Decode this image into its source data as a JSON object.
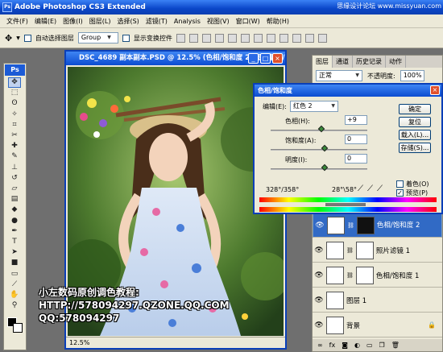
{
  "app": {
    "title": "Adobe Photoshop CS3 Extended",
    "logo": "Ps",
    "watermark": "思缘设计论坛 www.missyuan.com"
  },
  "menubar": [
    "文件(F)",
    "编辑(E)",
    "图像(I)",
    "图层(L)",
    "选择(S)",
    "滤镜(T)",
    "Analysis",
    "视图(V)",
    "窗口(W)",
    "帮助(H)"
  ],
  "options": {
    "auto_select_label": "自动选择图层",
    "auto_select_value": "Group",
    "show_transform_label": "显示变换控件"
  },
  "toolbox": {
    "logo": "Ps",
    "tools": [
      "move-icon",
      "marquee-icon",
      "lasso-icon",
      "magic-wand-icon",
      "crop-icon",
      "slice-icon",
      "healing-icon",
      "brush-icon",
      "stamp-icon",
      "history-brush-icon",
      "eraser-icon",
      "gradient-icon",
      "blur-icon",
      "dodge-icon",
      "pen-icon",
      "type-icon",
      "path-select-icon",
      "shape-icon",
      "notes-icon",
      "eyedropper-icon",
      "hand-icon",
      "zoom-icon"
    ]
  },
  "document": {
    "title": "DSC_4689 副本副本.PSD @ 12.5% (色相/饱和度 2, 图层蒙版/8)",
    "zoom": "12.5%"
  },
  "caption": {
    "line1": "小左数码原创调色教程:",
    "line2": "HTTP://578094297.QZONE.QQ.COM",
    "line3": "QQ:578094297"
  },
  "layers_panel": {
    "tabs": [
      "图层",
      "通道",
      "历史记录",
      "动作"
    ],
    "blend_mode": "正常",
    "opacity_label": "不透明度:",
    "opacity_value": "100%",
    "layers": [
      {
        "name": "色相/饱和度 2",
        "selected": true
      },
      {
        "name": "照片滤镜 1",
        "selected": false
      },
      {
        "name": "色相/饱和度 1",
        "selected": false
      },
      {
        "name": "图层 1",
        "selected": false
      },
      {
        "name": "背景",
        "selected": false
      }
    ]
  },
  "dialog": {
    "title": "色相/饱和度",
    "edit_label": "编辑(E):",
    "edit_value": "红色 2",
    "hue_label": "色相(H):",
    "hue_value": "+9",
    "hue_level": 9,
    "saturation_label": "饱和度(A):",
    "saturation_value": "0",
    "lightness_label": "明度(I):",
    "lightness_value": "0",
    "range_left": "328°/358°",
    "range_right": "28°\\58°",
    "buttons": [
      "确定",
      "复位",
      "载入(L)...",
      "存储(S)..."
    ],
    "colorize_label": "着色(O)",
    "preview_label": "预览(P)",
    "preview_checked": true,
    "colorize_checked": false
  }
}
